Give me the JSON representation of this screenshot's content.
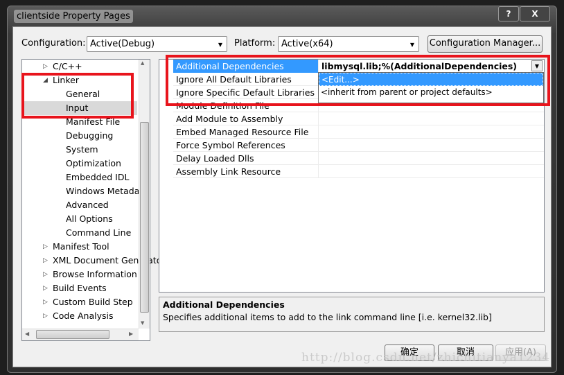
{
  "window": {
    "title": "clientside Property Pages",
    "help": "?",
    "close": "X"
  },
  "toolbar": {
    "config_label": "Configuration:",
    "config_value": "Active(Debug)",
    "platform_label": "Platform:",
    "platform_value": "Active(x64)",
    "config_manager": "Configuration Manager..."
  },
  "tree": {
    "items": [
      {
        "label": "C/C++",
        "level": 1,
        "expander": "collapsed"
      },
      {
        "label": "Linker",
        "level": 1,
        "expander": "expanded"
      },
      {
        "label": "General",
        "level": 2
      },
      {
        "label": "Input",
        "level": 2,
        "selected": true
      },
      {
        "label": "Manifest File",
        "level": 2
      },
      {
        "label": "Debugging",
        "level": 2
      },
      {
        "label": "System",
        "level": 2
      },
      {
        "label": "Optimization",
        "level": 2
      },
      {
        "label": "Embedded IDL",
        "level": 2
      },
      {
        "label": "Windows Metadata",
        "level": 2
      },
      {
        "label": "Advanced",
        "level": 2
      },
      {
        "label": "All Options",
        "level": 2
      },
      {
        "label": "Command Line",
        "level": 2
      },
      {
        "label": "Manifest Tool",
        "level": 1,
        "expander": "collapsed"
      },
      {
        "label": "XML Document Generator",
        "level": 1,
        "expander": "collapsed"
      },
      {
        "label": "Browse Information",
        "level": 1,
        "expander": "collapsed"
      },
      {
        "label": "Build Events",
        "level": 1,
        "expander": "collapsed"
      },
      {
        "label": "Custom Build Step",
        "level": 1,
        "expander": "collapsed"
      },
      {
        "label": "Code Analysis",
        "level": 1,
        "expander": "collapsed"
      }
    ]
  },
  "grid": {
    "rows": [
      {
        "name": "Additional Dependencies",
        "value": "libmysql.lib;%(AdditionalDependencies)"
      },
      {
        "name": "Ignore All Default Libraries",
        "value": ""
      },
      {
        "name": "Ignore Specific Default Libraries",
        "value": ""
      },
      {
        "name": "Module Definition File",
        "value": ""
      },
      {
        "name": "Add Module to Assembly",
        "value": ""
      },
      {
        "name": "Embed Managed Resource File",
        "value": ""
      },
      {
        "name": "Force Symbol References",
        "value": ""
      },
      {
        "name": "Delay Loaded Dlls",
        "value": ""
      },
      {
        "name": "Assembly Link Resource",
        "value": ""
      }
    ],
    "dropdown": [
      "<Edit...>",
      "<inherit from parent or project defaults>"
    ]
  },
  "description": {
    "title": "Additional Dependencies",
    "text": "Specifies additional items to add to the link command line [i.e. kernel32.lib]"
  },
  "buttons": {
    "ok": "确定",
    "cancel": "取消",
    "apply": "应用(A)"
  },
  "watermark": "http://blog.csdn.net/zhichitianya1234",
  "colors": {
    "selection": "#3399ff",
    "highlight_box": "#e8141c"
  }
}
